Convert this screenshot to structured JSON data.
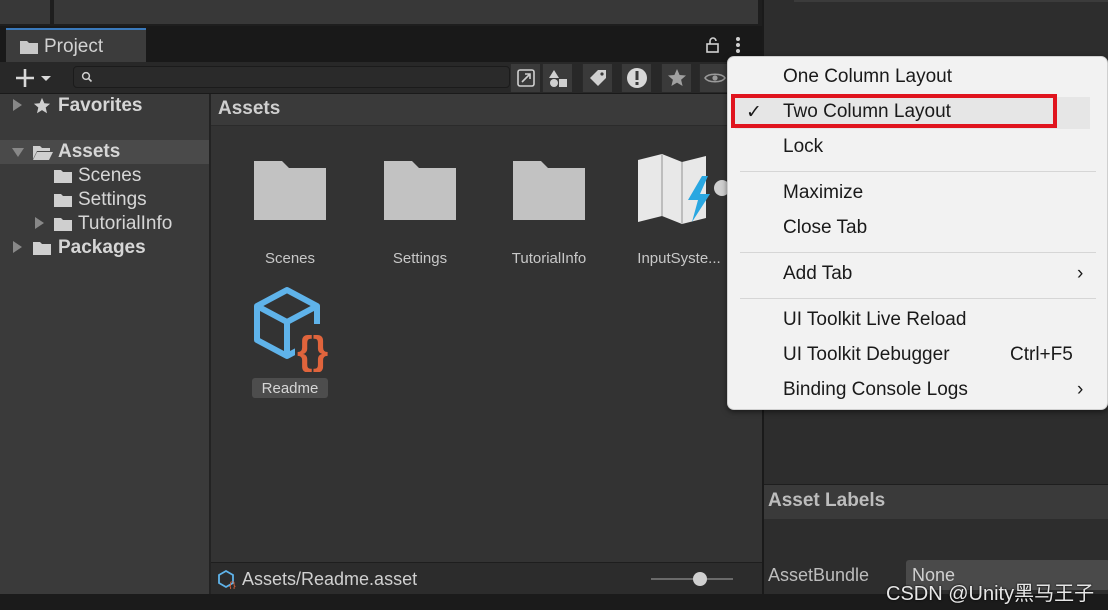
{
  "project_tab": {
    "label": "Project"
  },
  "tree": {
    "favorites": "Favorites",
    "assets": "Assets",
    "scenes": "Scenes",
    "settings": "Settings",
    "tutorialinfo": "TutorialInfo",
    "packages": "Packages"
  },
  "main": {
    "breadcrumb": "Assets",
    "assets": [
      "Scenes",
      "Settings",
      "TutorialInfo",
      "InputSyste..."
    ],
    "readme": "Readme",
    "status_path": "Assets/Readme.asset"
  },
  "right_panel": {
    "asset_labels": "Asset Labels",
    "assetbundle_label": "AssetBundle",
    "assetbundle_value": "None"
  },
  "menu": {
    "one_column": "One Column Layout",
    "two_column": "Two Column Layout",
    "check": "✓",
    "lock": "Lock",
    "maximize": "Maximize",
    "close_tab": "Close Tab",
    "add_tab": "Add Tab",
    "live_reload": "UI Toolkit Live Reload",
    "debugger": "UI Toolkit Debugger",
    "debugger_shortcut": "Ctrl+F5",
    "binding_logs": "Binding Console Logs",
    "chevron": "›"
  },
  "watermark": "CSDN @Unity黑马王子",
  "colors": {
    "highlight": "#e0141e",
    "accent_tab": "#3a79bb"
  }
}
